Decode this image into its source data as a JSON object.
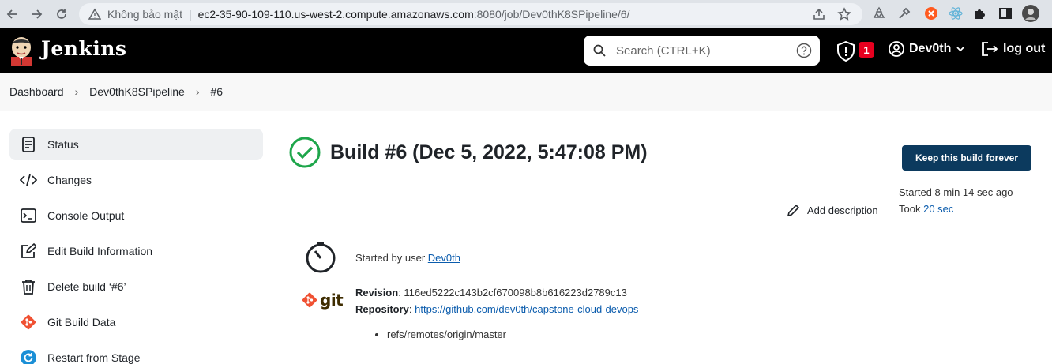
{
  "browser": {
    "security_label": "Không bảo mật",
    "url_host": "ec2-35-90-109-110.us-west-2.compute.amazonaws.com",
    "url_path": ":8080/job/Dev0thK8SPipeline/6/"
  },
  "header": {
    "brand": "Jenkins",
    "search_placeholder": "Search (CTRL+K)",
    "security_badge_count": "1",
    "user_name": "Dev0th",
    "logout_label": "log out"
  },
  "breadcrumb": {
    "items": [
      "Dashboard",
      "Dev0thK8SPipeline",
      "#6"
    ]
  },
  "sidebar": {
    "items": [
      {
        "label": "Status",
        "icon": "document-icon"
      },
      {
        "label": "Changes",
        "icon": "code-icon"
      },
      {
        "label": "Console Output",
        "icon": "terminal-icon"
      },
      {
        "label": "Edit Build Information",
        "icon": "edit-icon"
      },
      {
        "label": "Delete build ‘#6’",
        "icon": "trash-icon"
      },
      {
        "label": "Git Build Data",
        "icon": "git-icon"
      },
      {
        "label": "Restart from Stage",
        "icon": "restart-icon"
      }
    ]
  },
  "build": {
    "title": "Build #6 (Dec 5, 2022, 5:47:08 PM)",
    "keep_label": "Keep this build forever",
    "started_text": "Started 8 min 14 sec ago",
    "took_prefix": "Took",
    "took_value": "20 sec",
    "add_description": "Add description",
    "cause_prefix": "Started by user",
    "cause_user": "Dev0th",
    "revision_label": "Revision",
    "revision_value": "116ed5222c143b2cf670098b8b616223d2789c13",
    "repository_label": "Repository",
    "repository_value": "https://github.com/dev0th/capstone-cloud-devops",
    "refs": [
      "refs/remotes/origin/master"
    ]
  },
  "colors": {
    "success": "#1ea64b",
    "primary_button": "#0c3a5e",
    "link": "#0b5cad",
    "badge": "#e6001f",
    "git": "#f05133"
  }
}
